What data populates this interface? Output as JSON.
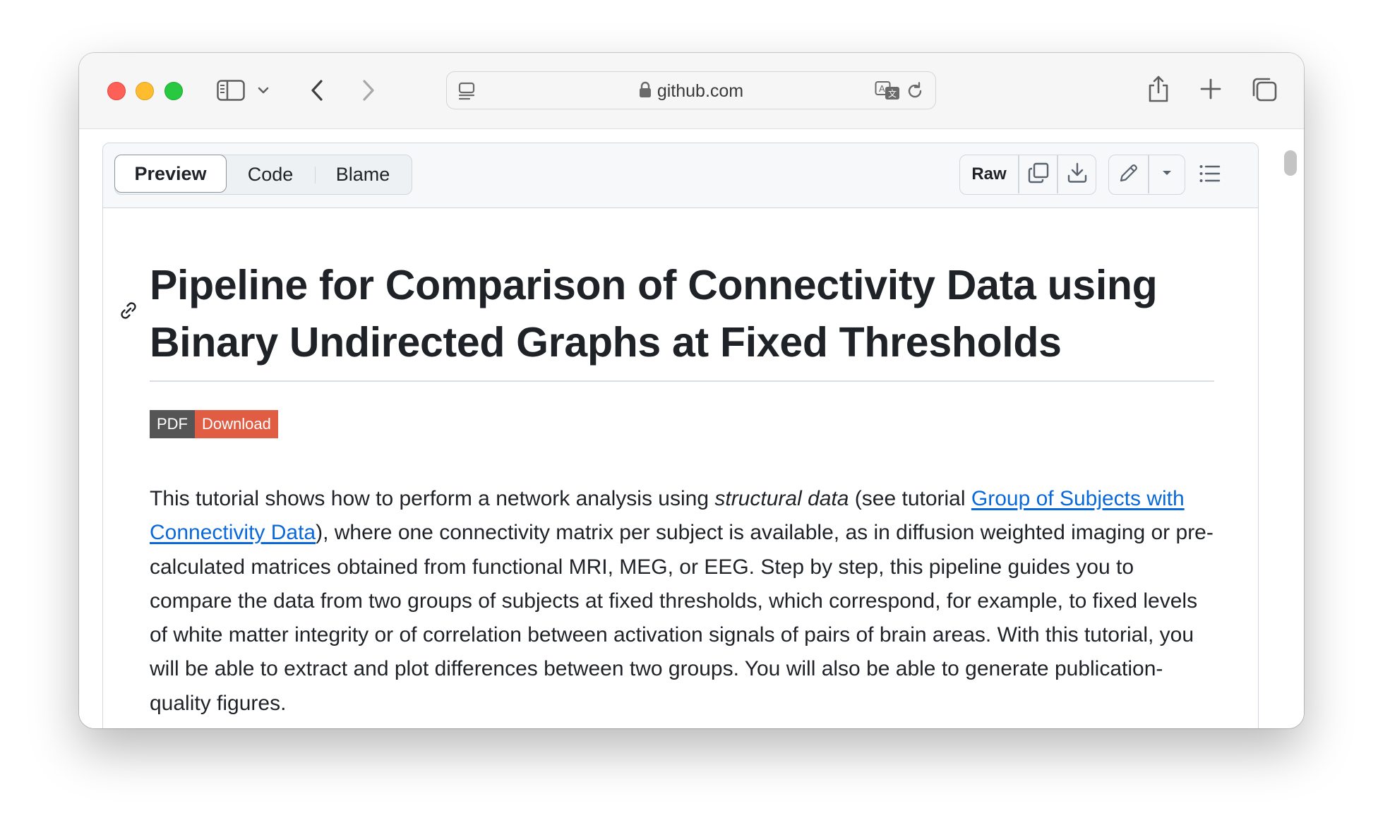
{
  "browser": {
    "url": "github.com",
    "icons": {
      "sidebar": "sidebar-icon",
      "back": "chevron-left-icon",
      "forward": "chevron-right-icon",
      "reader": "reader-icon",
      "lock": "lock-icon",
      "translate": "translate-icon",
      "reload": "reload-icon",
      "share": "share-icon",
      "new_tab": "plus-icon",
      "tabs": "tab-overview-icon"
    }
  },
  "file_header": {
    "tabs": [
      {
        "label": "Preview",
        "active": true
      },
      {
        "label": "Code",
        "active": false
      },
      {
        "label": "Blame",
        "active": false
      }
    ],
    "raw_label": "Raw"
  },
  "article": {
    "title": "Pipeline for Comparison of Connectivity Data using Binary Undirected Graphs at Fixed Thresholds",
    "badge": {
      "left": "PDF",
      "right": "Download",
      "right_color": "#e05d44"
    },
    "paragraph": {
      "part1": "This tutorial shows how to perform a network analysis using ",
      "emphasis": "structural data",
      "part2": " (see tutorial ",
      "link_text": "Group of Subjects with Connectivity Data",
      "part3": "), where one connectivity matrix per subject is available, as in diffusion weighted imaging or pre-calculated matrices obtained from functional MRI, MEG, or EEG. Step by step, this pipeline guides you to compare the data from two groups of subjects at fixed thresholds, which correspond, for example, to fixed levels of white matter integrity or of correlation between activation signals of pairs of brain areas. With this tutorial, you will be able to extract and plot differences between two groups. You will also be able to generate publication-quality figures."
    }
  },
  "colors": {
    "link": "#0969da",
    "text": "#1f2328",
    "border": "#d0d7de"
  }
}
